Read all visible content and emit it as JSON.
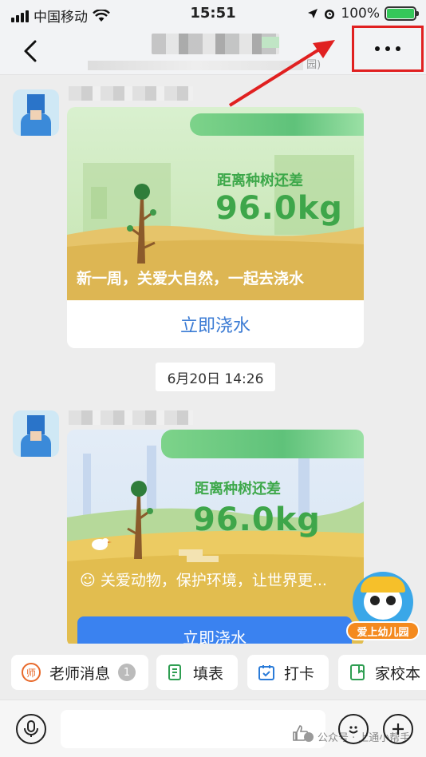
{
  "status_bar": {
    "carrier": "中国移动",
    "time": "15:51",
    "battery": "100%"
  },
  "nav": {
    "subtitle_suffix": "园)"
  },
  "messages": [
    {
      "banner_text": "新一周，关爱大自然，一起去浇水",
      "distance_label": "距离种树还差",
      "distance_value": "96.0kg",
      "button_label": "立即浇水"
    },
    {
      "banner_text": "☺ 关爱动物，保护环境，让世界更...",
      "distance_label": "距离种树还差",
      "distance_value": "96.0kg",
      "button_label": "立即浇水"
    }
  ],
  "timestamp": "6月20日 14:26",
  "mascot": {
    "label": "爱上幼儿园"
  },
  "quick_actions": [
    {
      "label": "老师消息",
      "badge": "1"
    },
    {
      "label": "填表"
    },
    {
      "label": "打卡"
    },
    {
      "label": "家校本"
    }
  ],
  "watermark": {
    "prefix": "公众号 ·",
    "name": "上通小帮手"
  },
  "colors": {
    "highlight_red": "#e02020",
    "accent_blue": "#3a82f0",
    "tree_green": "#3ea64a"
  }
}
